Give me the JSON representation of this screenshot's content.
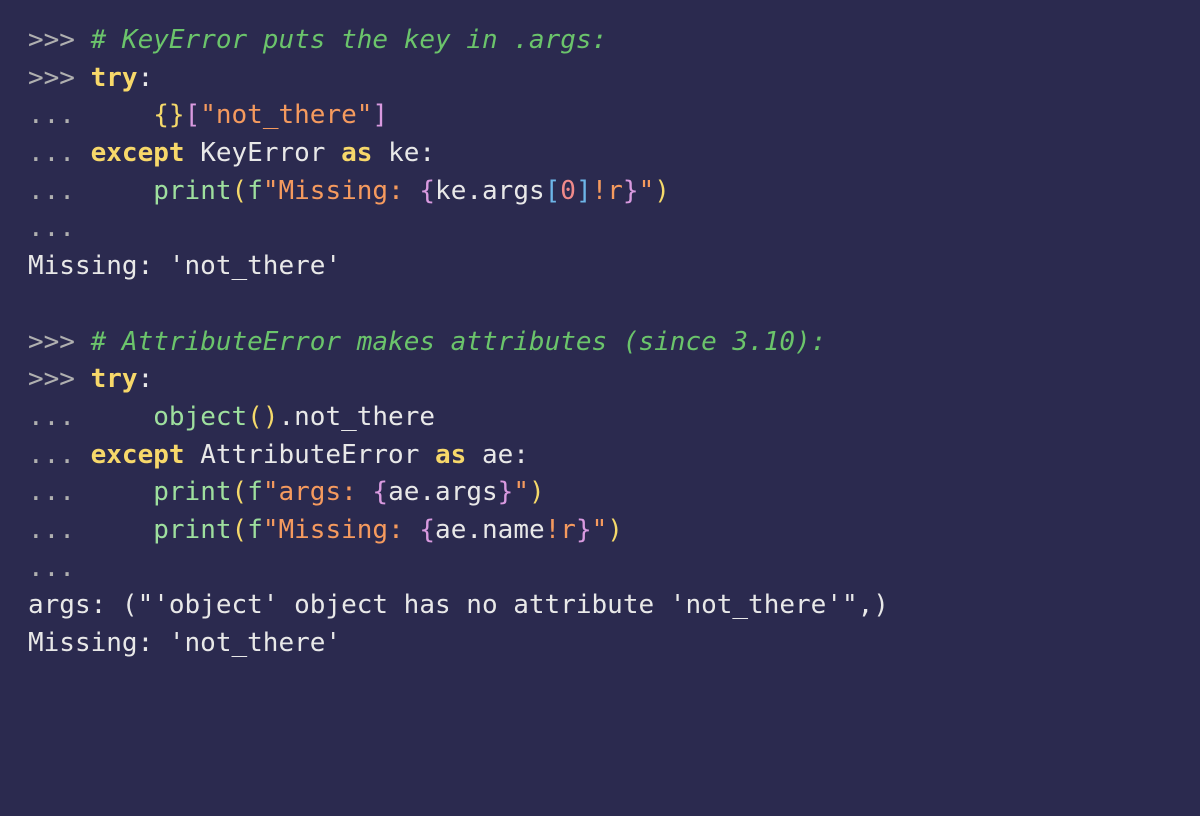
{
  "l1_prompt": ">>> ",
  "l1_comment": "# KeyError puts the key in .args:",
  "l2_prompt": ">>> ",
  "l2_try": "try",
  "l2_colon": ":",
  "l3_cont": "... ",
  "l3_indent": "    ",
  "l3_lb1": "{",
  "l3_rb1": "}",
  "l3_lb2": "[",
  "l3_str": "\"not_there\"",
  "l3_rb2": "]",
  "l4_cont": "... ",
  "l4_except": "except",
  "l4_sp1": " ",
  "l4_class": "KeyError",
  "l4_sp2": " ",
  "l4_as": "as",
  "l4_sp3": " ",
  "l4_var": "ke",
  "l4_colon": ":",
  "l5_cont": "... ",
  "l5_indent": "    ",
  "l5_print": "print",
  "l5_lp1": "(",
  "l5_f": "f",
  "l5_s1": "\"Missing: ",
  "l5_lbrace": "{",
  "l5_interp1": "ke.args",
  "l5_lb3": "[",
  "l5_num": "0",
  "l5_rb3": "]",
  "l5_fmt": "!r",
  "l5_rbrace": "}",
  "l5_s2": "\"",
  "l5_rp1": ")",
  "l6_cont": "... ",
  "l7_out": "Missing: 'not_there'",
  "l8_blank": "",
  "l9_prompt": ">>> ",
  "l9_comment": "# AttributeError makes attributes (since 3.10):",
  "l10_prompt": ">>> ",
  "l10_try": "try",
  "l10_colon": ":",
  "l11_cont": "... ",
  "l11_indent": "    ",
  "l11_obj": "object",
  "l11_lp": "(",
  "l11_rp": ")",
  "l11_dot": ".not_there",
  "l12_cont": "... ",
  "l12_except": "except",
  "l12_sp1": " ",
  "l12_class": "AttributeError",
  "l12_sp2": " ",
  "l12_as": "as",
  "l12_sp3": " ",
  "l12_var": "ae",
  "l12_colon": ":",
  "l13_cont": "... ",
  "l13_indent": "    ",
  "l13_print": "print",
  "l13_lp": "(",
  "l13_f": "f",
  "l13_s1": "\"args: ",
  "l13_lbrace": "{",
  "l13_interp": "ae.args",
  "l13_rbrace": "}",
  "l13_s2": "\"",
  "l13_rp": ")",
  "l14_cont": "... ",
  "l14_indent": "    ",
  "l14_print": "print",
  "l14_lp": "(",
  "l14_f": "f",
  "l14_s1": "\"Missing: ",
  "l14_lbrace": "{",
  "l14_interp": "ae.name",
  "l14_fmt": "!r",
  "l14_rbrace": "}",
  "l14_s2": "\"",
  "l14_rp": ")",
  "l15_cont": "... ",
  "l16_out": "args: (\"'object' object has no attribute 'not_there'\",)",
  "l17_out": "Missing: 'not_there'"
}
